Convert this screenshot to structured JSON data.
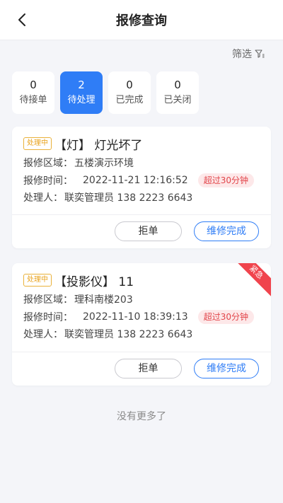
{
  "header": {
    "title": "报修查询"
  },
  "filter": {
    "label": "筛选"
  },
  "tabs": [
    {
      "count": "0",
      "label": "待接单",
      "active": false
    },
    {
      "count": "2",
      "label": "待处理",
      "active": true
    },
    {
      "count": "0",
      "label": "已完成",
      "active": false
    },
    {
      "count": "0",
      "label": "已关闭",
      "active": false
    }
  ],
  "orders": [
    {
      "status": "处理中",
      "title": "【灯】 灯光坏了",
      "area_label": "报修区域：",
      "area": "五楼演示环境",
      "time_label": "报修时间：",
      "time": "2022-11-21 12:16:52",
      "overdue": "超过30分钟",
      "handler_label": "处理人：",
      "handler": "联奕管理员 138 2223 6643",
      "urgent": "",
      "reject_label": "拒单",
      "complete_label": "维修完成"
    },
    {
      "status": "处理中",
      "title": "【投影仪】 11",
      "area_label": "报修区域：",
      "area": "理科南楼203",
      "time_label": "报修时间：",
      "time": "2022-11-10 18:39:13",
      "overdue": "超过30分钟",
      "handler_label": "处理人：",
      "handler": "联奕管理员 138 2223 6643",
      "urgent": "紧急",
      "reject_label": "拒单",
      "complete_label": "维修完成"
    }
  ],
  "footer": {
    "no_more": "没有更多了"
  },
  "colors": {
    "accent": "#2f7df6",
    "warning": "#e9a21a",
    "danger": "#e2454a",
    "background": "#f4f5f9"
  },
  "icons": {
    "back": "chevron-left-icon",
    "filter": "filter-icon"
  }
}
